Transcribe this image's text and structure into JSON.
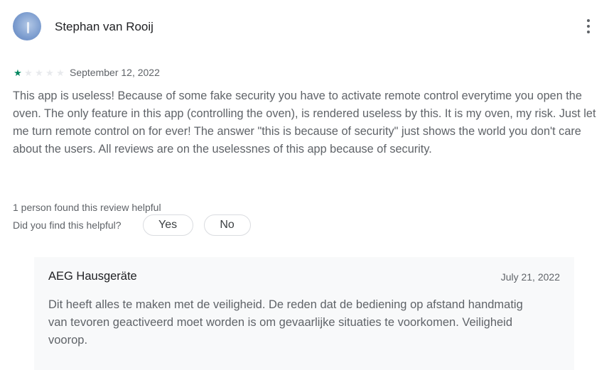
{
  "review": {
    "author": "Stephan van Rooij",
    "rating": 1,
    "max_rating": 5,
    "date": "September 12, 2022",
    "text": "This app is useless! Because of some fake security you have to activate remote control everytime you open the oven. The only feature in this app (controlling the oven), is rendered useless by this. It is my oven, my risk. Just let me turn remote control on for ever! The answer \"this is because of security\" just shows the world you don't care about the users. All reviews are on the uselessnes of this app because of security.",
    "helpful_count_text": "1 person found this review helpful",
    "helpful_question": "Did you find this helpful?",
    "yes_label": "Yes",
    "no_label": "No",
    "star_color_filled": "#01875f",
    "star_color_empty": "#e8eaed",
    "icons": {
      "avatar": "user-avatar-photo",
      "menu": "more-vert-icon",
      "star": "star-icon"
    }
  },
  "developer_reply": {
    "author": "AEG Hausgeräte",
    "date": "July 21, 2022",
    "text": "Dit heeft alles te maken met de veiligheid. De reden dat de bediening op afstand handmatig van tevoren geactiveerd moet worden is om gevaarlijke situaties te voorkomen. Veiligheid voorop."
  }
}
